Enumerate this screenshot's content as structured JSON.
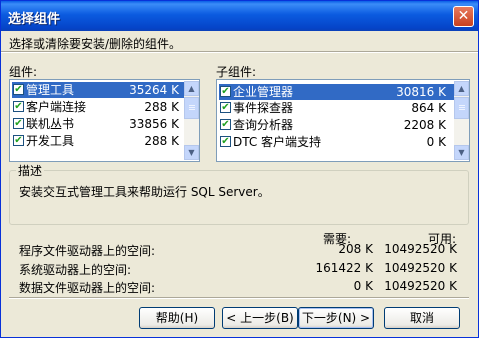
{
  "window": {
    "title": "选择组件",
    "close_glyph": "✕"
  },
  "instruction": "选择或清除要安装/删除的组件。",
  "components": {
    "label": "组件:",
    "items": [
      {
        "name": "管理工具",
        "size": "35264 K",
        "checked": true,
        "selected": true
      },
      {
        "name": "客户端连接",
        "size": "288 K",
        "checked": true,
        "selected": false
      },
      {
        "name": "联机丛书",
        "size": "33856 K",
        "checked": true,
        "selected": false
      },
      {
        "name": "开发工具",
        "size": "288 K",
        "checked": true,
        "selected": false
      }
    ]
  },
  "subcomponents": {
    "label": "子组件:",
    "items": [
      {
        "name": "企业管理器",
        "size": "30816 K",
        "checked": true,
        "selected": true
      },
      {
        "name": "事件探查器",
        "size": "864 K",
        "checked": true,
        "selected": false
      },
      {
        "name": "查询分析器",
        "size": "2208 K",
        "checked": true,
        "selected": false
      },
      {
        "name": "DTC 客户端支持",
        "size": "0 K",
        "checked": true,
        "selected": false
      }
    ]
  },
  "description": {
    "title": "描述",
    "text": "安装交互式管理工具来帮助运行 SQL Server。"
  },
  "space": {
    "required_header": "需要:",
    "available_header": "可用:",
    "rows": [
      {
        "label": "程序文件驱动器上的空间:",
        "required": "208 K",
        "available": "10492520 K"
      },
      {
        "label": "系统驱动器上的空间:",
        "required": "161422 K",
        "available": "10492520 K"
      },
      {
        "label": "数据文件驱动器上的空间:",
        "required": "0 K",
        "available": "10492520 K"
      }
    ]
  },
  "buttons": {
    "help": "帮助(H)",
    "back": "< 上一步(B)",
    "next": "下一步(N) >",
    "cancel": "取消"
  },
  "colors": {
    "title_bar": "#0A5FE6",
    "selection": "#316AC5",
    "dialog_bg": "#ECE9D8"
  },
  "icons": {
    "check": "✔",
    "scroll_up": "▲",
    "scroll_down": "▼"
  }
}
